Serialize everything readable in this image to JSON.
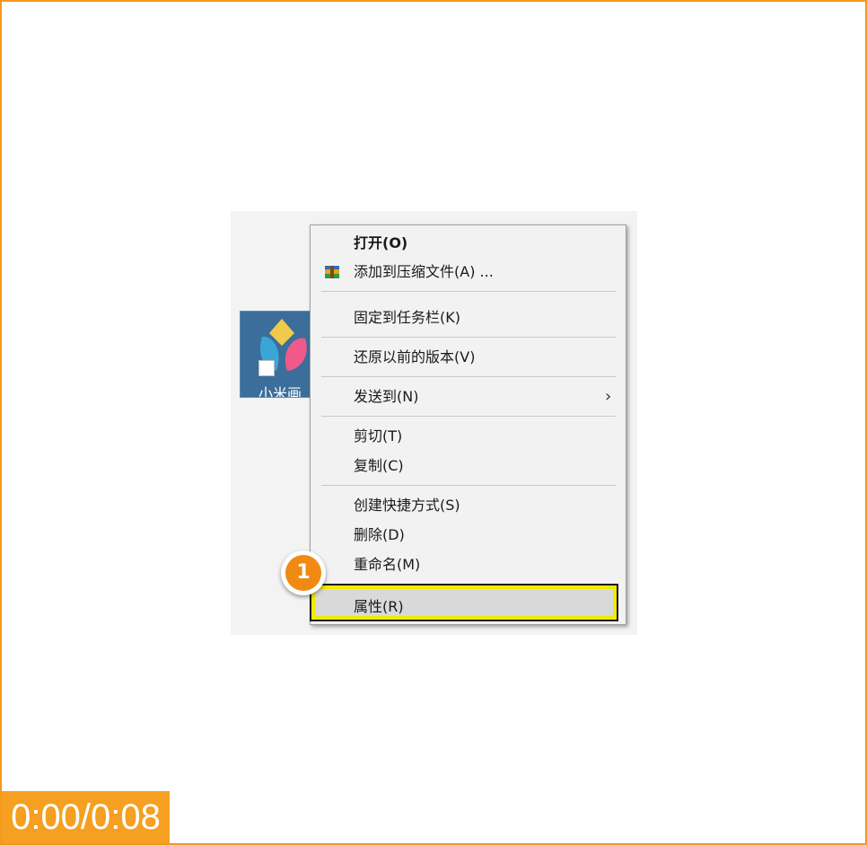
{
  "desktop": {
    "icon_label": "小米画"
  },
  "context_menu": {
    "items": [
      {
        "label": "打开(O)"
      },
      {
        "label": "添加到压缩文件(A) ..."
      },
      {
        "label": "固定到任务栏(K)"
      },
      {
        "label": "还原以前的版本(V)"
      },
      {
        "label": "发送到(N)"
      },
      {
        "label": "剪切(T)"
      },
      {
        "label": "复制(C)"
      },
      {
        "label": "创建快捷方式(S)"
      },
      {
        "label": "删除(D)"
      },
      {
        "label": "重命名(M)"
      },
      {
        "label": "属性(R)"
      }
    ],
    "submenu_glyph": "›"
  },
  "step_badge": {
    "number": "1"
  },
  "player": {
    "timestamp": "0:00/0:08"
  },
  "colors": {
    "frame": "#f39a1e",
    "highlight_border": "#f2ea00",
    "badge": "#f08a12",
    "timer_bg": "#f5a020"
  }
}
